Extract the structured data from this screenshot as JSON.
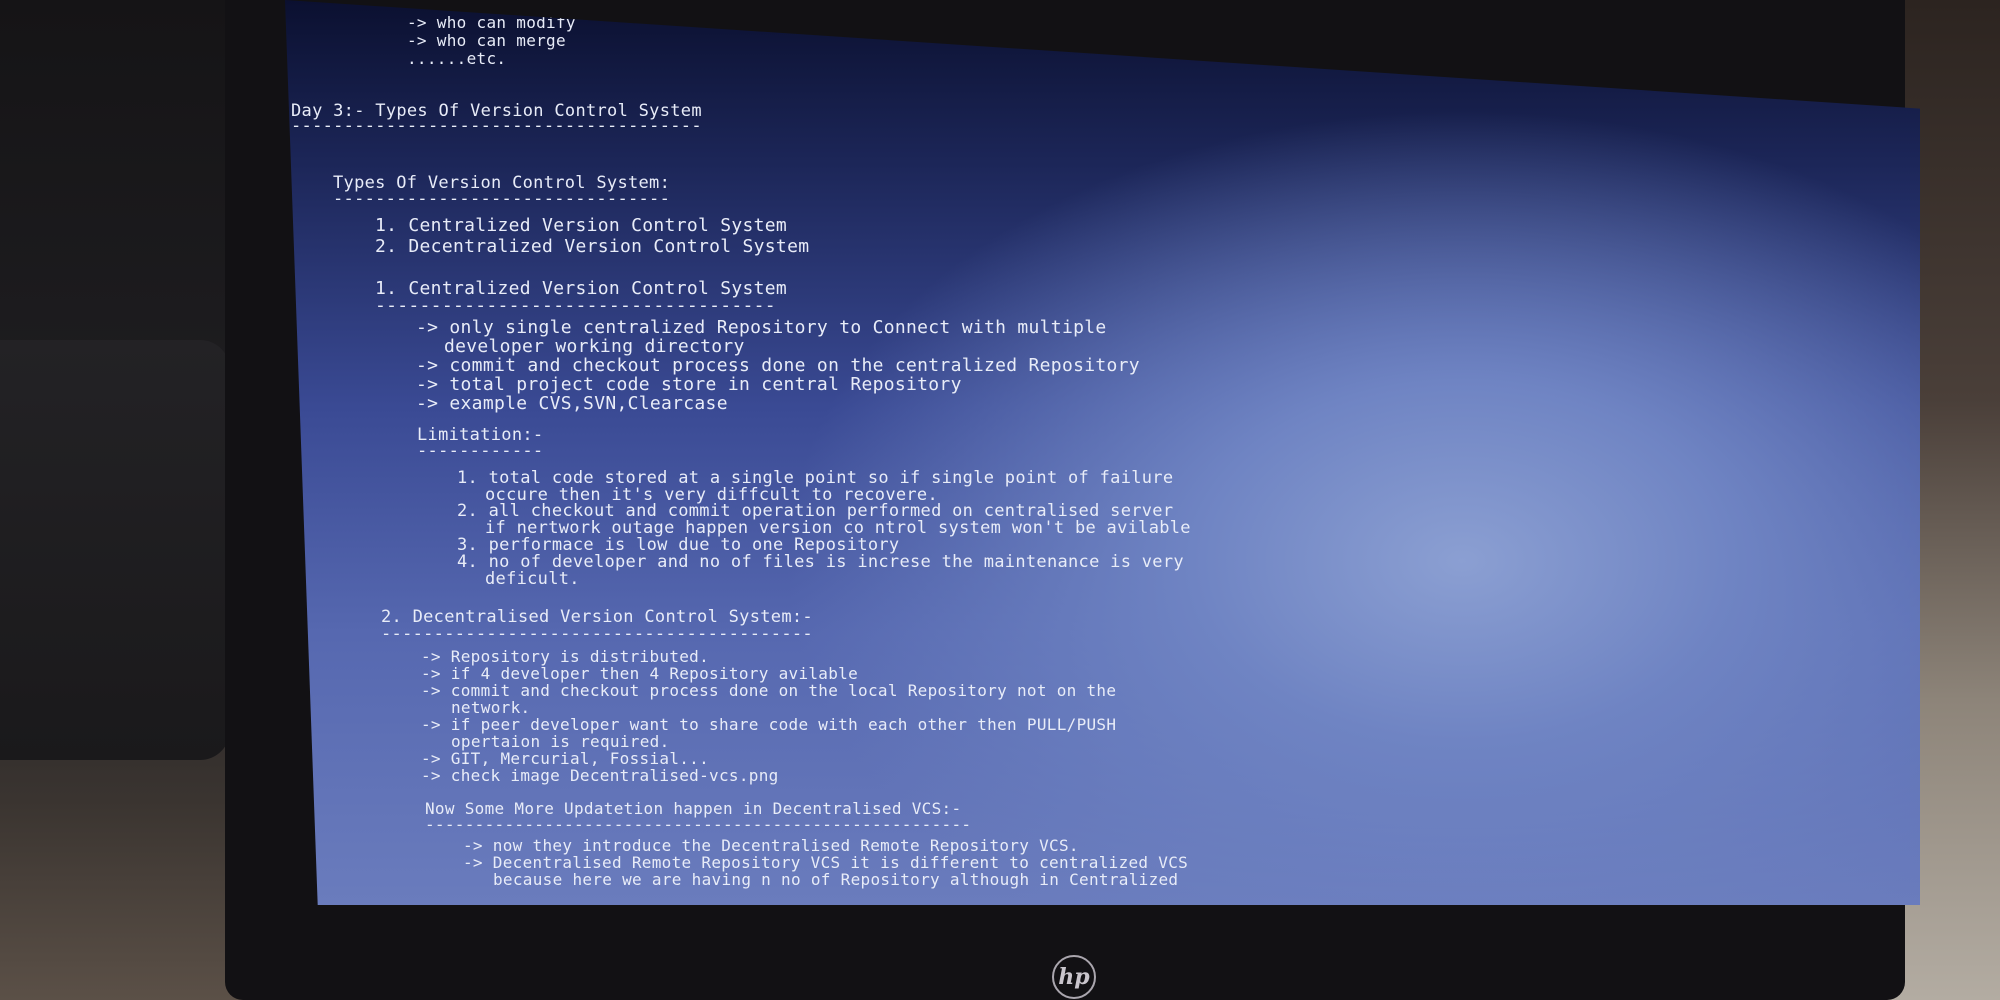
{
  "brand_logo": "hp",
  "colors": {
    "terminal_text": "#e8ecf8",
    "screen_blue": "#5668b0"
  },
  "terminal_lines": [
    "-> who can modify",
    "-> who can merge",
    "......etc.",
    "Day 3:- Types Of Version Control System",
    "---------------------------------------",
    "Types Of Version Control System:",
    "--------------------------------",
    "1. Centralized Version Control System",
    "2. Decentralized Version Control System",
    "1. Centralized Version Control System",
    "------------------------------------",
    "-> only single centralized Repository to Connect with multiple",
    "developer working directory",
    "-> commit and checkout process done on the centralized Repository",
    "-> total project code store in central Repository",
    "-> example CVS,SVN,Clearcase",
    "Limitation:-",
    "------------",
    "1. total code stored at a single point so if single point of failure",
    "occure then it's very diffcult to recovere.",
    "2. all checkout and commit operation performed on centralised server",
    "if nertwork outage happen version co ntrol system won't be avilable",
    "3. performace is low due to one Repository",
    "4. no of developer and no of files is increse the maintenance is very",
    "deficult.",
    "2. Decentralised Version Control System:-",
    "-----------------------------------------",
    "-> Repository is distributed.",
    "-> if 4 developer then 4 Repository avilable",
    "-> commit and checkout process done on the local Repository not on the",
    "network.",
    "-> if peer developer want to share code with each other then PULL/PUSH",
    "opertaion is required.",
    "-> GIT, Mercurial, Fossial...",
    "-> check image Decentralised-vcs.png",
    "Now Some More Updatetion happen in Decentralised VCS:-",
    "-------------------------------------------------------",
    "-> now they introduce the Decentralised Remote Repository VCS.",
    "-> Decentralised Remote Repository VCS it is different to centralized VCS",
    "because here we are having n no of Repository although in Centralized"
  ]
}
